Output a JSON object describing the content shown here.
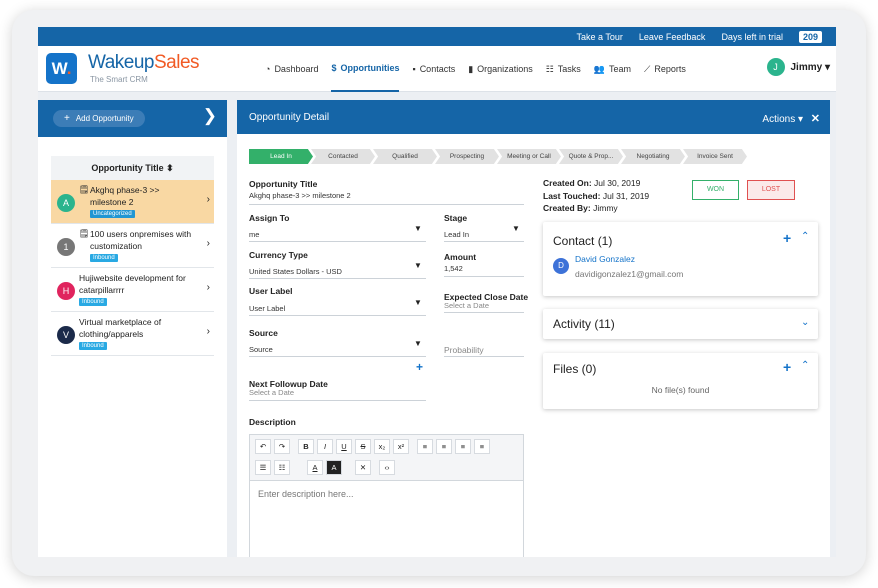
{
  "topbar": {
    "take_tour": "Take a Tour",
    "leave_feedback": "Leave Feedback",
    "trial_label": "Days left in trial",
    "trial_days": "209"
  },
  "brand": {
    "logo_letter": "W",
    "logo_dot": ".",
    "name_part1": "Wakeup",
    "name_part2": "Sales",
    "tagline": "The Smart CRM",
    "primary_color": "#1565a7",
    "accent_color": "#f15a24"
  },
  "nav": {
    "items": [
      {
        "label": "Dashboard",
        "icon": "dashboard-icon",
        "glyph": "◔"
      },
      {
        "label": "Opportunities",
        "icon": "dollar-icon",
        "glyph": "$"
      },
      {
        "label": "Contacts",
        "icon": "contact-card-icon",
        "glyph": "▪"
      },
      {
        "label": "Organizations",
        "icon": "building-icon",
        "glyph": "▮"
      },
      {
        "label": "Tasks",
        "icon": "tasks-list-icon",
        "glyph": "☷"
      },
      {
        "label": "Team",
        "icon": "team-icon",
        "glyph": "👥"
      },
      {
        "label": "Reports",
        "icon": "chart-line-icon",
        "glyph": "⟋"
      }
    ],
    "active_index": 1
  },
  "user": {
    "initial": "J",
    "name": "Jimmy",
    "caret": "▾"
  },
  "left": {
    "add_label": "Add Opportunity",
    "column_header": "Opportunity Title ⬍",
    "opportunities": [
      {
        "initial": "A",
        "avatar_color": "#2bb48d",
        "title": "Akghq phase-3 >> milestone 2",
        "tag": "Uncategorized",
        "has_note": true,
        "selected": true
      },
      {
        "initial": "1",
        "avatar_color": "#777777",
        "title": "100 users onpremises with customization",
        "tag": "Inbound",
        "has_note": true,
        "selected": false
      },
      {
        "initial": "H",
        "avatar_color": "#e0245e",
        "title": "Hujiwebsite development for catarpillarrrr",
        "tag": "Inbound",
        "has_note": false,
        "selected": false
      },
      {
        "initial": "V",
        "avatar_color": "#1b2a4a",
        "title": "Virtual marketplace of clothing/apparels",
        "tag": "Inbound",
        "has_note": false,
        "selected": false
      }
    ]
  },
  "detail": {
    "title": "Opportunity Detail",
    "actions_label": "Actions ▾",
    "close_glyph": "✕",
    "stages": [
      "Lead In",
      "Contacted",
      "Qualified",
      "Prospecting",
      "Meeting or Call",
      "Quote & Prop...",
      "Negotiating",
      "Invoice Sent"
    ],
    "active_stage": 0,
    "opportunity_title_label": "Opportunity Title",
    "opportunity_title_value": "Akghq phase-3 >> milestone 2",
    "assign_to_label": "Assign To",
    "assign_to_value": "me",
    "stage_label": "Stage",
    "stage_value": "Lead In",
    "currency_label": "Currency Type",
    "currency_value": "United States Dollars - USD",
    "amount_label": "Amount",
    "amount_value": "1,542",
    "user_label_label": "User Label",
    "user_label_value": "User Label",
    "expected_close_label": "Expected Close Date",
    "expected_close_placeholder": "Select a Date",
    "source_label": "Source",
    "source_value": "Source",
    "probability_placeholder": "Probability",
    "next_followup_label": "Next Followup Date",
    "next_followup_placeholder": "Select a Date",
    "description_label": "Description",
    "description_placeholder": "Enter description here...",
    "created_on_label": "Created On:",
    "created_on_value": "Jul 30, 2019",
    "last_touched_label": "Last Touched:",
    "last_touched_value": "Jul 31, 2019",
    "created_by_label": "Created By:",
    "created_by_value": "Jimmy",
    "won_label": "WON",
    "lost_label": "LOST"
  },
  "cards": {
    "contact_title": "Contact (1)",
    "contact_initial": "D",
    "contact_name": "David Gonzalez",
    "contact_email": "davidigonzalez1@gmail.com",
    "activity_title": "Activity (11)",
    "files_title": "Files (0)",
    "no_files": "No file(s) found"
  },
  "toolbar_glyphs": {
    "undo": "↶",
    "redo": "↷",
    "bold": "B",
    "italic": "I",
    "underline": "U",
    "strike": "S",
    "subscript": "x₂",
    "superscript": "x²",
    "align_left": "≡",
    "align_center": "≡",
    "align_right": "≡",
    "justify": "≡",
    "bullets": "☰",
    "numbers": "☷",
    "font_color": "A",
    "highlight": "A",
    "clear": "✕",
    "code": "‹›"
  }
}
